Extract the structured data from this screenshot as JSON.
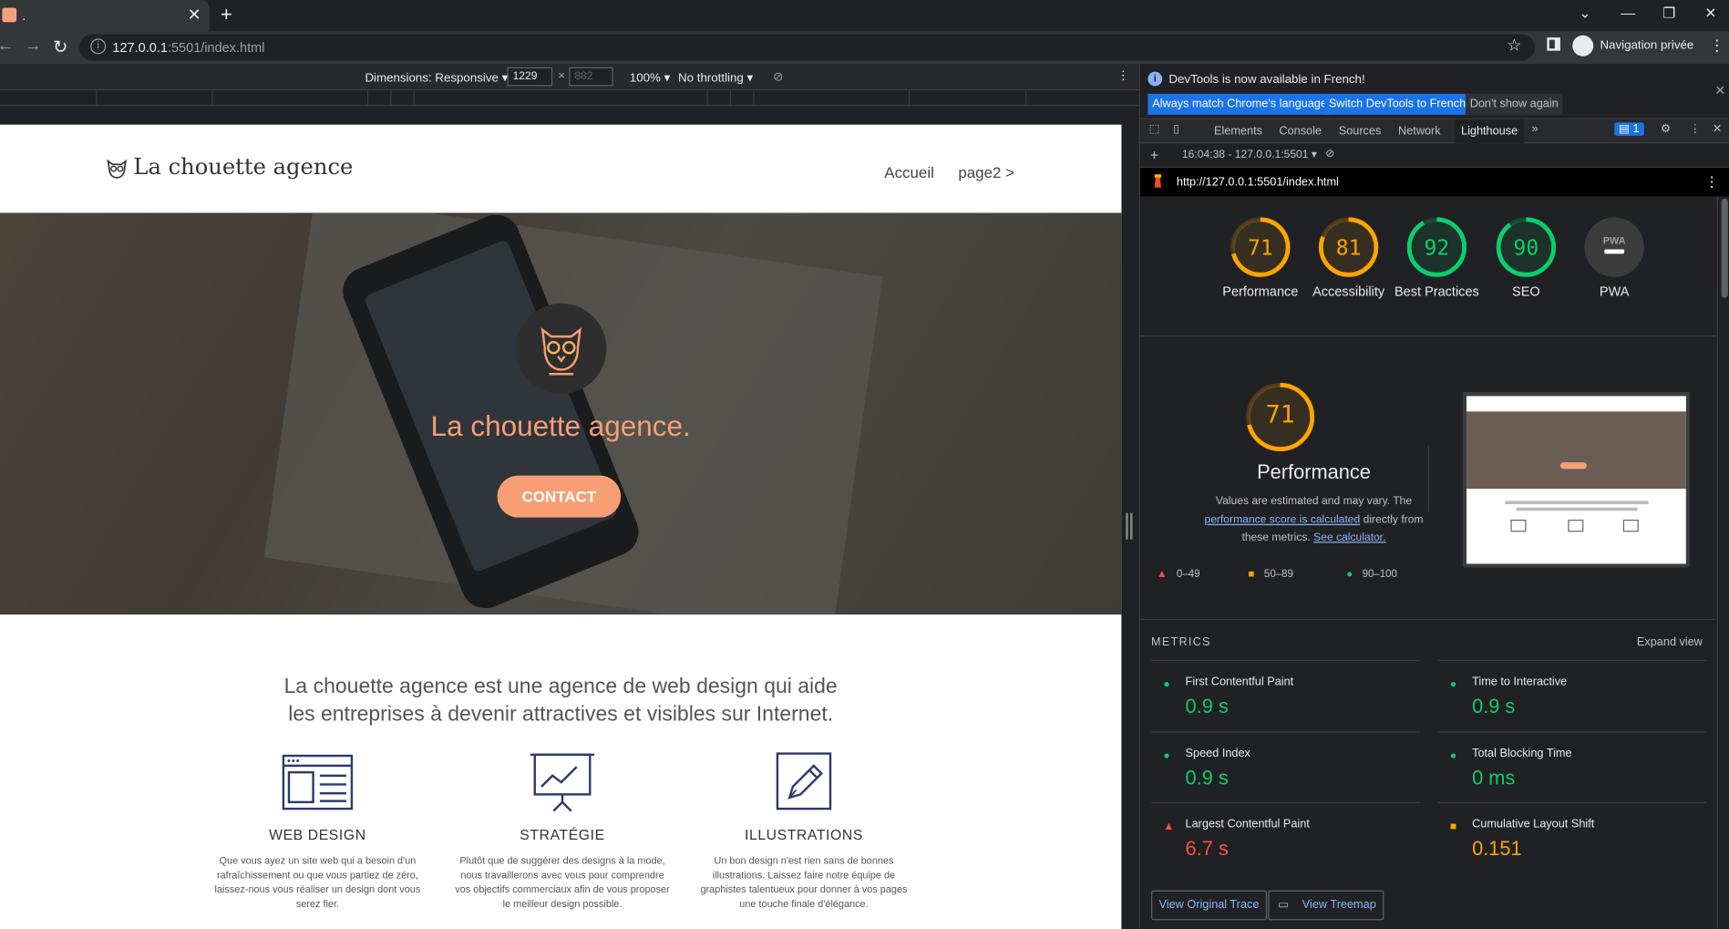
{
  "browser": {
    "tab_title": ".",
    "new_tab": "+",
    "url_host": "127.0.0.1",
    "url_rest": ":5501/index.html",
    "profile_label": "Navigation privée"
  },
  "device_toolbar": {
    "dimensions_label": "Dimensions: Responsive",
    "width": "1229",
    "height": "882",
    "zoom": "100%",
    "throttling": "No throttling"
  },
  "site": {
    "brand": "La chouette agence",
    "nav": [
      "Accueil",
      "page2 >"
    ],
    "hero_title": "La chouette agence.",
    "hero_button": "CONTACT",
    "intro_line1": "La chouette agence est une agence de web design qui aide",
    "intro_line2": "les entreprises à devenir attractives et visibles sur Internet.",
    "services": [
      {
        "icon": "web-design-icon",
        "title": "WEB DESIGN",
        "text": "Que vous ayez un site web qui a besoin d'un rafraîchissement ou que vous partiez de zéro, laissez-nous vous réaliser un design dont vous serez fier."
      },
      {
        "icon": "strategy-icon",
        "title": "STRATÉGIE",
        "text": "Plutôt que de suggérer des designs à la mode, nous travaillerons avec vous pour comprendre vos objectifs commerciaux afin de vous proposer le meilleur design possible."
      },
      {
        "icon": "illustrations-icon",
        "title": "ILLUSTRATIONS",
        "text": "Un bon design n'est rien sans de bonnes illustrations. Laissez faire notre équipe de graphistes talentueux pour donner à vos pages une touche finale d'élégance."
      }
    ],
    "accent": "#f79e75"
  },
  "devtools": {
    "notice": "DevTools is now available in French!",
    "btn_match": "Always match Chrome's language",
    "btn_switch": "Switch DevTools to French",
    "btn_dont": "Don't show again",
    "tabs": [
      "Elements",
      "Console",
      "Sources",
      "Network",
      "Lighthouse"
    ],
    "active_tab": "Lighthouse",
    "issues_count": "1",
    "report_select": "16:04:38 - 127.0.0.1:5501",
    "report_url": "http://127.0.0.1:5501/index.html",
    "scores": [
      {
        "label": "Performance",
        "value": "71",
        "score": 71,
        "color": "#ffa400"
      },
      {
        "label": "Accessibility",
        "value": "81",
        "score": 81,
        "color": "#ffa400"
      },
      {
        "label": "Best Practices",
        "value": "92",
        "score": 92,
        "color": "#0cce6b"
      },
      {
        "label": "SEO",
        "value": "90",
        "score": 90,
        "color": "#0cce6b"
      },
      {
        "label": "PWA",
        "value": "PWA",
        "score": null,
        "color": "#9aa0a6"
      }
    ],
    "perf_title": "Performance",
    "perf_value": "71",
    "perf_desc_1": "Values are estimated and may vary. The",
    "perf_link": "performance score is calculated",
    "perf_desc_2": "directly from these metrics.",
    "perf_calc": "See calculator.",
    "legend": [
      "0–49",
      "50–89",
      "90–100"
    ],
    "metrics_header": "METRICS",
    "expand": "Expand view",
    "metrics": [
      {
        "name": "First Contentful Paint",
        "value": "0.9 s",
        "status": "good"
      },
      {
        "name": "Time to Interactive",
        "value": "0.9 s",
        "status": "good"
      },
      {
        "name": "Speed Index",
        "value": "0.9 s",
        "status": "good"
      },
      {
        "name": "Total Blocking Time",
        "value": "0 ms",
        "status": "good"
      },
      {
        "name": "Largest Contentful Paint",
        "value": "6.7 s",
        "status": "bad"
      },
      {
        "name": "Cumulative Layout Shift",
        "value": "0.151",
        "status": "avg"
      }
    ],
    "btn_trace": "View Original Trace",
    "btn_treemap": "View Treemap"
  }
}
